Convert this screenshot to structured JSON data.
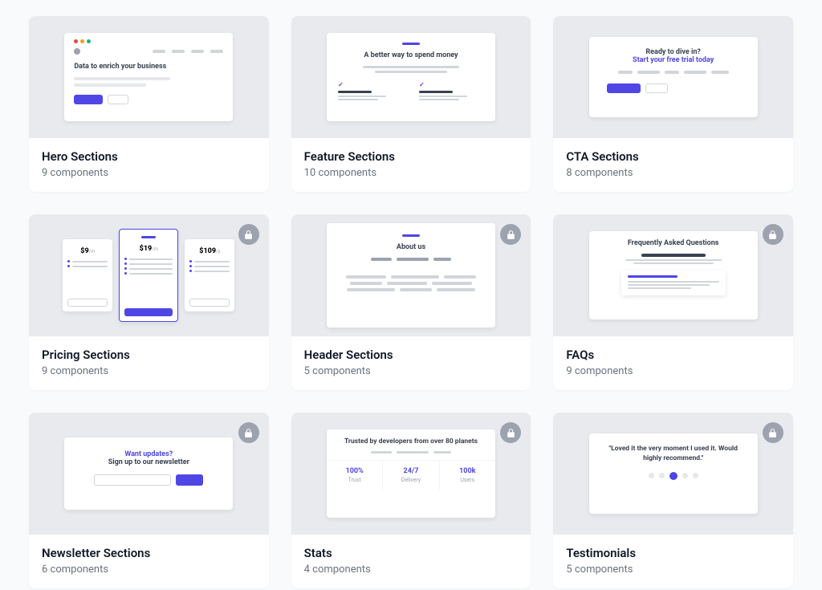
{
  "cards": [
    {
      "title": "Hero Sections",
      "sub": "9 components",
      "locked": false
    },
    {
      "title": "Feature Sections",
      "sub": "10 components",
      "locked": false
    },
    {
      "title": "CTA Sections",
      "sub": "8 components",
      "locked": false
    },
    {
      "title": "Pricing Sections",
      "sub": "9 components",
      "locked": true
    },
    {
      "title": "Header Sections",
      "sub": "5 components",
      "locked": true
    },
    {
      "title": "FAQs",
      "sub": "9 components",
      "locked": true
    },
    {
      "title": "Newsletter Sections",
      "sub": "6 components",
      "locked": true
    },
    {
      "title": "Stats",
      "sub": "4 components",
      "locked": true
    },
    {
      "title": "Testimonials",
      "sub": "5 components",
      "locked": true
    }
  ],
  "previews": {
    "hero": {
      "headline": "Data to enrich your business"
    },
    "feature": {
      "headline": "A better way to spend money"
    },
    "cta": {
      "line1": "Ready to dive in?",
      "line2": "Start your free trial today"
    },
    "pricing": {
      "left": "$9",
      "left_unit": "/m",
      "mid": "$19",
      "mid_unit": "/m",
      "right": "$109",
      "right_unit": "/y"
    },
    "header": {
      "headline": "About us"
    },
    "faq": {
      "headline": "Frequently Asked Questions"
    },
    "newsletter": {
      "line1": "Want updates?",
      "line2": "Sign up to our newsletter"
    },
    "stats": {
      "headline": "Trusted by developers from over 80 planets",
      "items": [
        {
          "value": "100%",
          "label": "Trust"
        },
        {
          "value": "24/7",
          "label": "Delivery"
        },
        {
          "value": "100k",
          "label": "Users"
        }
      ]
    },
    "testimonial": {
      "quote": "\"Loved it the very moment I used it. Would highly recommend.\""
    }
  }
}
